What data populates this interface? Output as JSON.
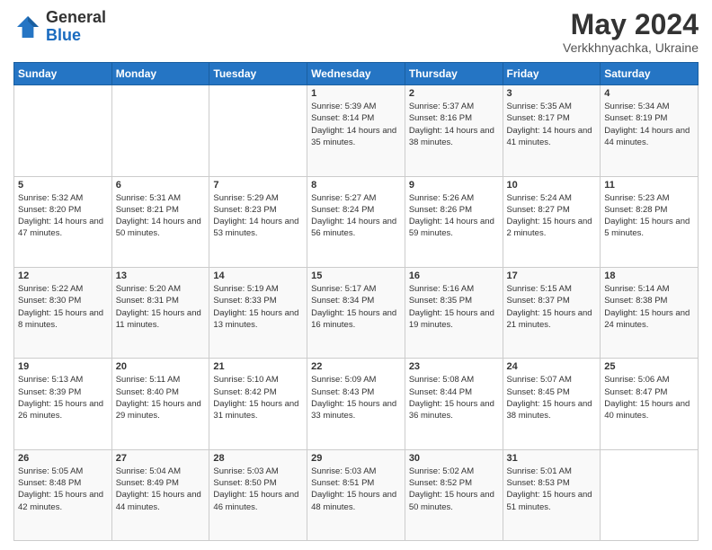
{
  "header": {
    "logo_general": "General",
    "logo_blue": "Blue",
    "main_title": "May 2024",
    "subtitle": "Verkkhnyachka, Ukraine"
  },
  "days_of_week": [
    "Sunday",
    "Monday",
    "Tuesday",
    "Wednesday",
    "Thursday",
    "Friday",
    "Saturday"
  ],
  "weeks": [
    [
      {
        "day": "",
        "sunrise": "",
        "sunset": "",
        "daylight": ""
      },
      {
        "day": "",
        "sunrise": "",
        "sunset": "",
        "daylight": ""
      },
      {
        "day": "",
        "sunrise": "",
        "sunset": "",
        "daylight": ""
      },
      {
        "day": "1",
        "sunrise": "Sunrise: 5:39 AM",
        "sunset": "Sunset: 8:14 PM",
        "daylight": "Daylight: 14 hours and 35 minutes."
      },
      {
        "day": "2",
        "sunrise": "Sunrise: 5:37 AM",
        "sunset": "Sunset: 8:16 PM",
        "daylight": "Daylight: 14 hours and 38 minutes."
      },
      {
        "day": "3",
        "sunrise": "Sunrise: 5:35 AM",
        "sunset": "Sunset: 8:17 PM",
        "daylight": "Daylight: 14 hours and 41 minutes."
      },
      {
        "day": "4",
        "sunrise": "Sunrise: 5:34 AM",
        "sunset": "Sunset: 8:19 PM",
        "daylight": "Daylight: 14 hours and 44 minutes."
      }
    ],
    [
      {
        "day": "5",
        "sunrise": "Sunrise: 5:32 AM",
        "sunset": "Sunset: 8:20 PM",
        "daylight": "Daylight: 14 hours and 47 minutes."
      },
      {
        "day": "6",
        "sunrise": "Sunrise: 5:31 AM",
        "sunset": "Sunset: 8:21 PM",
        "daylight": "Daylight: 14 hours and 50 minutes."
      },
      {
        "day": "7",
        "sunrise": "Sunrise: 5:29 AM",
        "sunset": "Sunset: 8:23 PM",
        "daylight": "Daylight: 14 hours and 53 minutes."
      },
      {
        "day": "8",
        "sunrise": "Sunrise: 5:27 AM",
        "sunset": "Sunset: 8:24 PM",
        "daylight": "Daylight: 14 hours and 56 minutes."
      },
      {
        "day": "9",
        "sunrise": "Sunrise: 5:26 AM",
        "sunset": "Sunset: 8:26 PM",
        "daylight": "Daylight: 14 hours and 59 minutes."
      },
      {
        "day": "10",
        "sunrise": "Sunrise: 5:24 AM",
        "sunset": "Sunset: 8:27 PM",
        "daylight": "Daylight: 15 hours and 2 minutes."
      },
      {
        "day": "11",
        "sunrise": "Sunrise: 5:23 AM",
        "sunset": "Sunset: 8:28 PM",
        "daylight": "Daylight: 15 hours and 5 minutes."
      }
    ],
    [
      {
        "day": "12",
        "sunrise": "Sunrise: 5:22 AM",
        "sunset": "Sunset: 8:30 PM",
        "daylight": "Daylight: 15 hours and 8 minutes."
      },
      {
        "day": "13",
        "sunrise": "Sunrise: 5:20 AM",
        "sunset": "Sunset: 8:31 PM",
        "daylight": "Daylight: 15 hours and 11 minutes."
      },
      {
        "day": "14",
        "sunrise": "Sunrise: 5:19 AM",
        "sunset": "Sunset: 8:33 PM",
        "daylight": "Daylight: 15 hours and 13 minutes."
      },
      {
        "day": "15",
        "sunrise": "Sunrise: 5:17 AM",
        "sunset": "Sunset: 8:34 PM",
        "daylight": "Daylight: 15 hours and 16 minutes."
      },
      {
        "day": "16",
        "sunrise": "Sunrise: 5:16 AM",
        "sunset": "Sunset: 8:35 PM",
        "daylight": "Daylight: 15 hours and 19 minutes."
      },
      {
        "day": "17",
        "sunrise": "Sunrise: 5:15 AM",
        "sunset": "Sunset: 8:37 PM",
        "daylight": "Daylight: 15 hours and 21 minutes."
      },
      {
        "day": "18",
        "sunrise": "Sunrise: 5:14 AM",
        "sunset": "Sunset: 8:38 PM",
        "daylight": "Daylight: 15 hours and 24 minutes."
      }
    ],
    [
      {
        "day": "19",
        "sunrise": "Sunrise: 5:13 AM",
        "sunset": "Sunset: 8:39 PM",
        "daylight": "Daylight: 15 hours and 26 minutes."
      },
      {
        "day": "20",
        "sunrise": "Sunrise: 5:11 AM",
        "sunset": "Sunset: 8:40 PM",
        "daylight": "Daylight: 15 hours and 29 minutes."
      },
      {
        "day": "21",
        "sunrise": "Sunrise: 5:10 AM",
        "sunset": "Sunset: 8:42 PM",
        "daylight": "Daylight: 15 hours and 31 minutes."
      },
      {
        "day": "22",
        "sunrise": "Sunrise: 5:09 AM",
        "sunset": "Sunset: 8:43 PM",
        "daylight": "Daylight: 15 hours and 33 minutes."
      },
      {
        "day": "23",
        "sunrise": "Sunrise: 5:08 AM",
        "sunset": "Sunset: 8:44 PM",
        "daylight": "Daylight: 15 hours and 36 minutes."
      },
      {
        "day": "24",
        "sunrise": "Sunrise: 5:07 AM",
        "sunset": "Sunset: 8:45 PM",
        "daylight": "Daylight: 15 hours and 38 minutes."
      },
      {
        "day": "25",
        "sunrise": "Sunrise: 5:06 AM",
        "sunset": "Sunset: 8:47 PM",
        "daylight": "Daylight: 15 hours and 40 minutes."
      }
    ],
    [
      {
        "day": "26",
        "sunrise": "Sunrise: 5:05 AM",
        "sunset": "Sunset: 8:48 PM",
        "daylight": "Daylight: 15 hours and 42 minutes."
      },
      {
        "day": "27",
        "sunrise": "Sunrise: 5:04 AM",
        "sunset": "Sunset: 8:49 PM",
        "daylight": "Daylight: 15 hours and 44 minutes."
      },
      {
        "day": "28",
        "sunrise": "Sunrise: 5:03 AM",
        "sunset": "Sunset: 8:50 PM",
        "daylight": "Daylight: 15 hours and 46 minutes."
      },
      {
        "day": "29",
        "sunrise": "Sunrise: 5:03 AM",
        "sunset": "Sunset: 8:51 PM",
        "daylight": "Daylight: 15 hours and 48 minutes."
      },
      {
        "day": "30",
        "sunrise": "Sunrise: 5:02 AM",
        "sunset": "Sunset: 8:52 PM",
        "daylight": "Daylight: 15 hours and 50 minutes."
      },
      {
        "day": "31",
        "sunrise": "Sunrise: 5:01 AM",
        "sunset": "Sunset: 8:53 PM",
        "daylight": "Daylight: 15 hours and 51 minutes."
      },
      {
        "day": "",
        "sunrise": "",
        "sunset": "",
        "daylight": ""
      }
    ]
  ]
}
